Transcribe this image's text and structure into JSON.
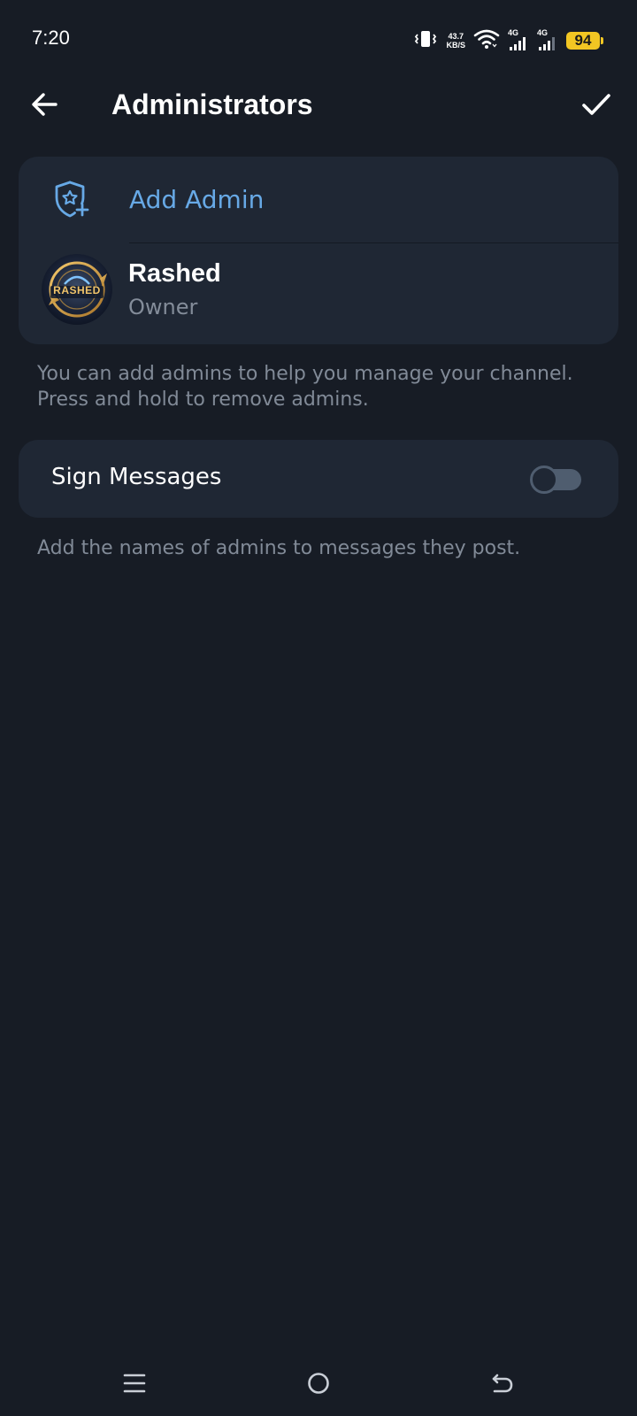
{
  "status_bar": {
    "time": "7:20",
    "net_speed_value": "43.7",
    "net_speed_unit": "KB/S",
    "signal_1_label": "4G",
    "signal_2_label": "4G",
    "battery_level": "94"
  },
  "header": {
    "title": "Administrators",
    "back_icon": "arrow-left-icon",
    "done_icon": "checkmark-icon"
  },
  "admins": {
    "add_label": "Add Admin",
    "add_icon": "shield-star-plus-icon",
    "list": [
      {
        "name": "Rashed",
        "role": "Owner",
        "avatar_text": "RASHED"
      }
    ],
    "hint": "You can add admins to help you manage your channel. Press and hold to remove admins."
  },
  "sign_messages": {
    "label": "Sign Messages",
    "enabled": false,
    "hint": "Add the names of admins to messages they post."
  },
  "colors": {
    "background": "#171c25",
    "card": "#1f2734",
    "accent": "#67a9e6",
    "secondary_text": "#818a97",
    "battery": "#f2c623"
  }
}
